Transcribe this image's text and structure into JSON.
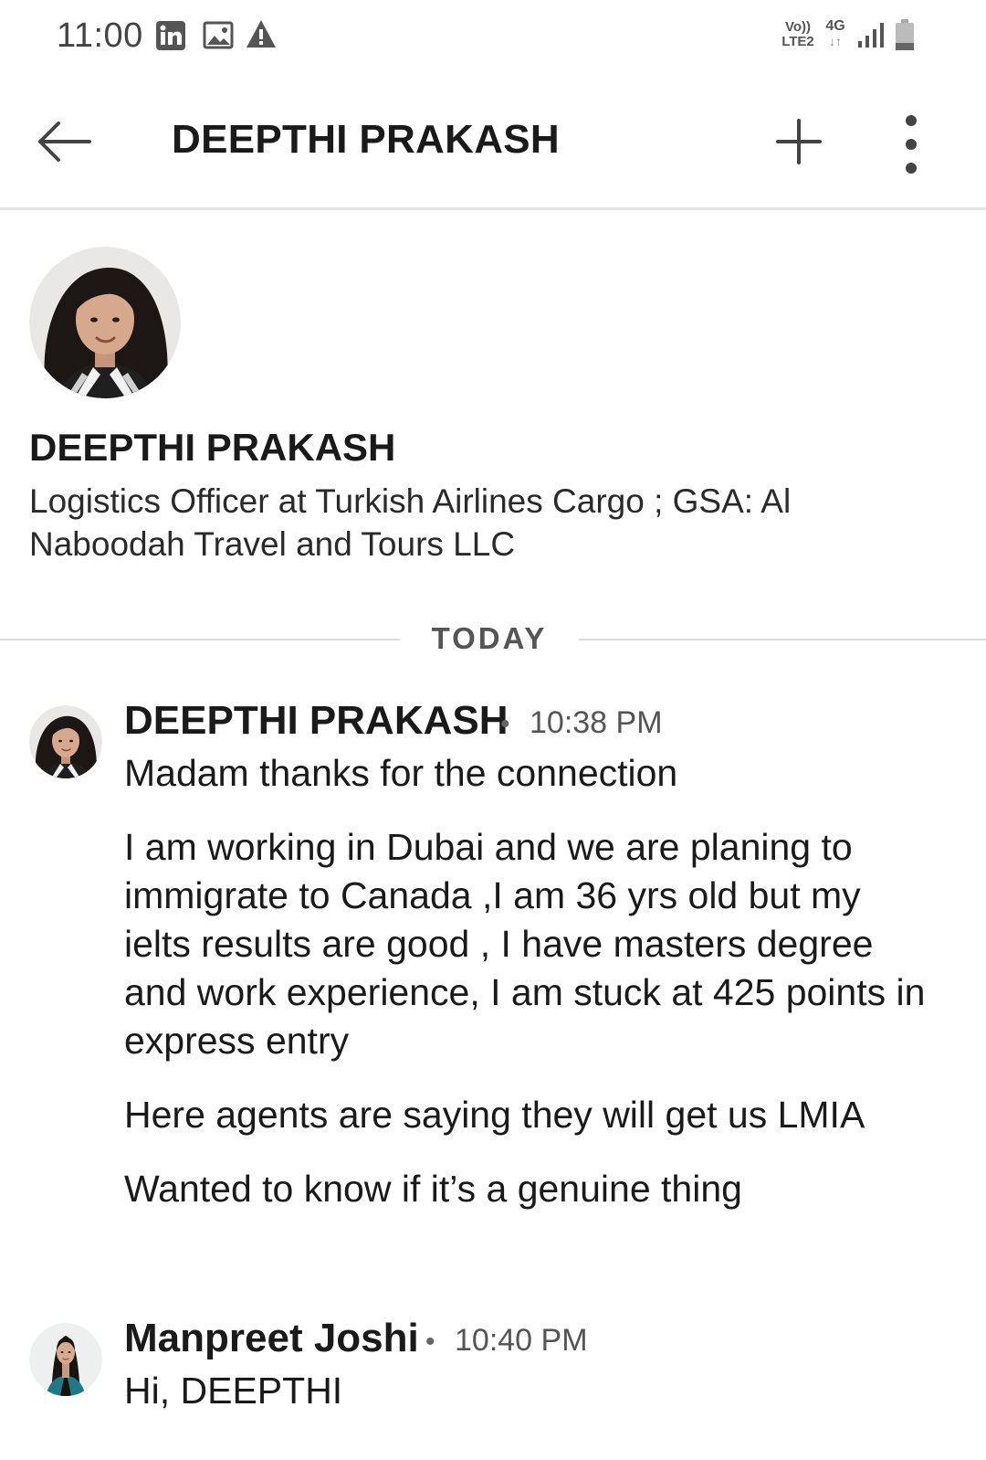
{
  "status_bar": {
    "time": "11:00",
    "network_volte_top": "Vo))",
    "network_volte_bottom": "LTE2",
    "network_type": "4G",
    "network_arrows": "↓↑",
    "notification_icons": [
      "linkedin-icon",
      "image-icon",
      "warning-icon"
    ]
  },
  "app_bar": {
    "title": "DEEPTHI PRAKASH"
  },
  "profile": {
    "name": "DEEPTHI PRAKASH",
    "headline": "Logistics Officer at Turkish Airlines Cargo ; GSA: Al Naboodah Travel and Tours LLC"
  },
  "divider": {
    "label": "TODAY"
  },
  "messages": [
    {
      "sender": "DEEPTHI PRAKASH",
      "separator": "•",
      "time": "10:38 PM",
      "paragraphs": [
        "Madam thanks for the connection",
        "I am working in Dubai and we are planing to immigrate to Canada ,I am 36 yrs old but my ielts results are good , I have masters degree and work experience, I am stuck at 425 points in express entry",
        "Here agents are saying they will get us LMIA",
        "Wanted to know if it’s a genuine thing"
      ]
    },
    {
      "sender": "Manpreet Joshi",
      "separator": "•",
      "time": "10:40 PM",
      "paragraphs": [
        "Hi, DEEPTHI"
      ]
    }
  ],
  "colors": {
    "text_primary": "#1a1a1a",
    "text_secondary": "#555555",
    "divider": "#dcdcdc",
    "background": "#ffffff"
  }
}
